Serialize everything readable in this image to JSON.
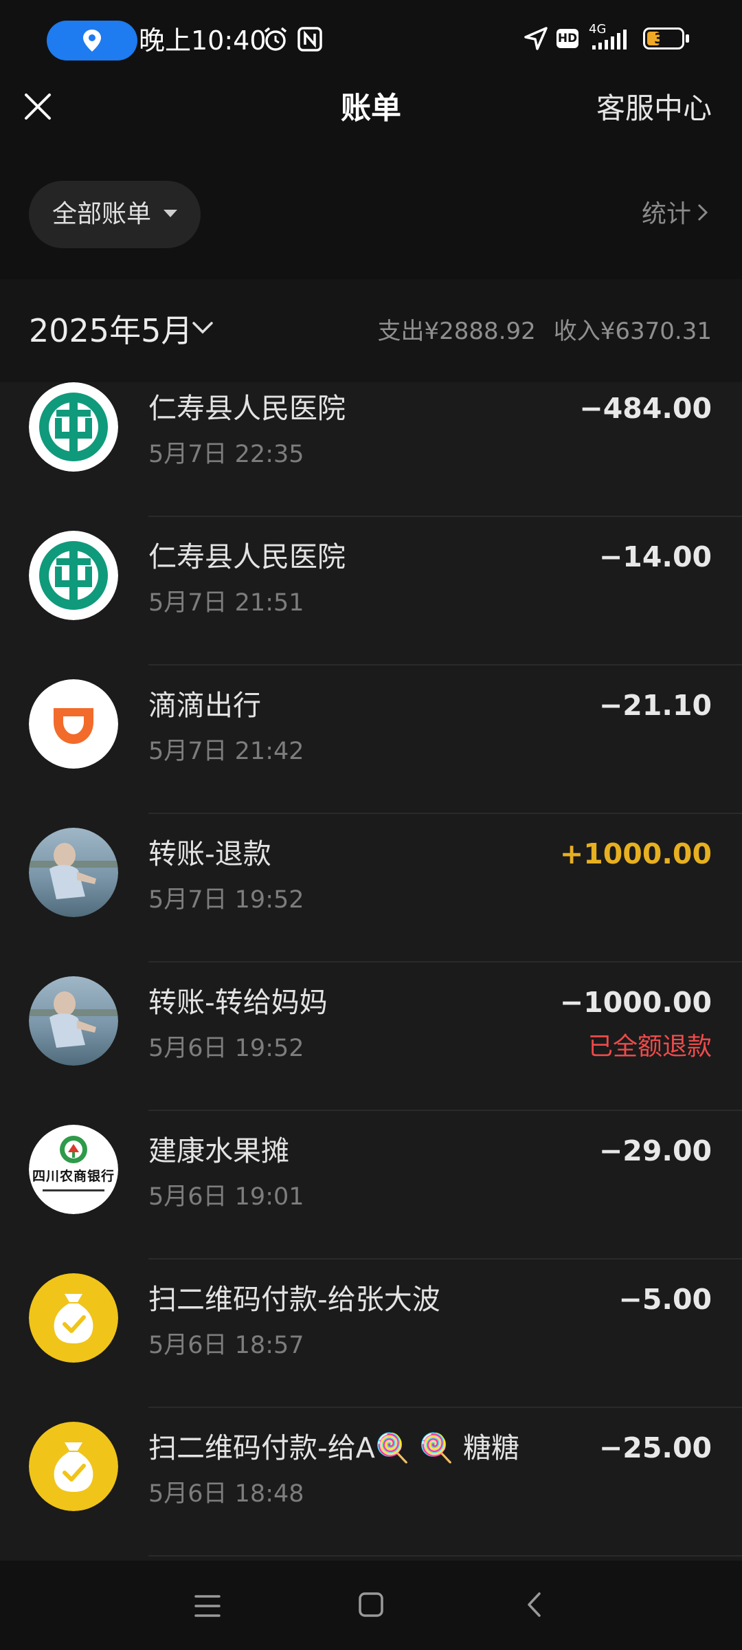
{
  "status_bar": {
    "time": "晚上10:40",
    "network": "4G",
    "hd_label": "HD",
    "battery_percent": 37
  },
  "header": {
    "title": "账单",
    "service_label": "客服中心",
    "filter_label": "全部账单",
    "stats_label": "统计"
  },
  "month": {
    "label": "2025年5月",
    "expense": "支出¥2888.92",
    "income": "收入¥6370.31"
  },
  "transactions": [
    {
      "icon": "abc-bank-icon",
      "title": "仁寿县人民医院",
      "time": "5月7日 22:35",
      "amount": "−484.00"
    },
    {
      "icon": "abc-bank-icon",
      "title": "仁寿县人民医院",
      "time": "5月7日 21:51",
      "amount": "−14.00"
    },
    {
      "icon": "didi-icon",
      "title": "滴滴出行",
      "time": "5月7日 21:42",
      "amount": "−21.10"
    },
    {
      "icon": "user-photo-avatar",
      "title": "转账-退款",
      "time": "5月7日 19:52",
      "amount": "+1000.00"
    },
    {
      "icon": "user-photo-avatar",
      "title": "转账-转给妈妈",
      "time": "5月6日 19:52",
      "amount": "−1000.00",
      "status": "已全额退款"
    },
    {
      "icon": "sichuan-rural-bank-icon",
      "title": "建康水果摊",
      "time": "5月6日 19:01",
      "amount": "−29.00",
      "logo_text": "四川农商银行"
    },
    {
      "icon": "money-bag-icon",
      "title": "扫二维码付款-给张大波",
      "time": "5月6日 18:57",
      "amount": "−5.00"
    },
    {
      "icon": "money-bag-icon",
      "title": "扫二维码付款-给A🍭 🍭 糖糖",
      "time": "5月6日 18:48",
      "amount": "−25.00"
    }
  ],
  "colors": {
    "income": "#e7b021",
    "refund_status": "#f04a4a",
    "abc_green": "#0f9a7c",
    "didi_orange": "#f26b2a",
    "wechat_pay_yellow": "#f0c419",
    "location_blue": "#1e7bf0"
  }
}
